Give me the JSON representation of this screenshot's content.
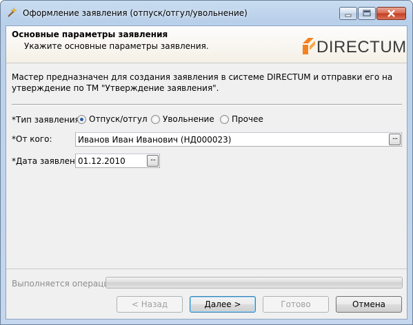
{
  "window": {
    "title": "Оформление заявления (отпуск/отгул/увольнение)",
    "icon": "wand-icon"
  },
  "header": {
    "title": "Основные параметры заявления",
    "subtitle": "Укажите основные параметры заявления.",
    "logo_text": "DIRECTUM",
    "logo_color": "#f58220"
  },
  "description": "Мастер предназначен для создания заявления в системе DIRECTUM и отправки его на утверждение по ТМ \"Утверждение заявления\".",
  "form": {
    "type_label": "*Тип заявления:",
    "type_options": [
      {
        "label": "Отпуск/отгул",
        "selected": true
      },
      {
        "label": "Увольнение",
        "selected": false
      },
      {
        "label": "Прочее",
        "selected": false
      }
    ],
    "from_label": "*От кого:",
    "from_value": "Иванов Иван Иванович (НД000023)",
    "date_label": "*Дата заявления:",
    "date_value": "01.12.2010",
    "ellipsis": "..."
  },
  "progress": {
    "label": "Выполняется операция",
    "value": 0
  },
  "buttons": {
    "back": "< Назад",
    "next": "Далее >",
    "finish": "Готово",
    "cancel": "Отмена"
  }
}
